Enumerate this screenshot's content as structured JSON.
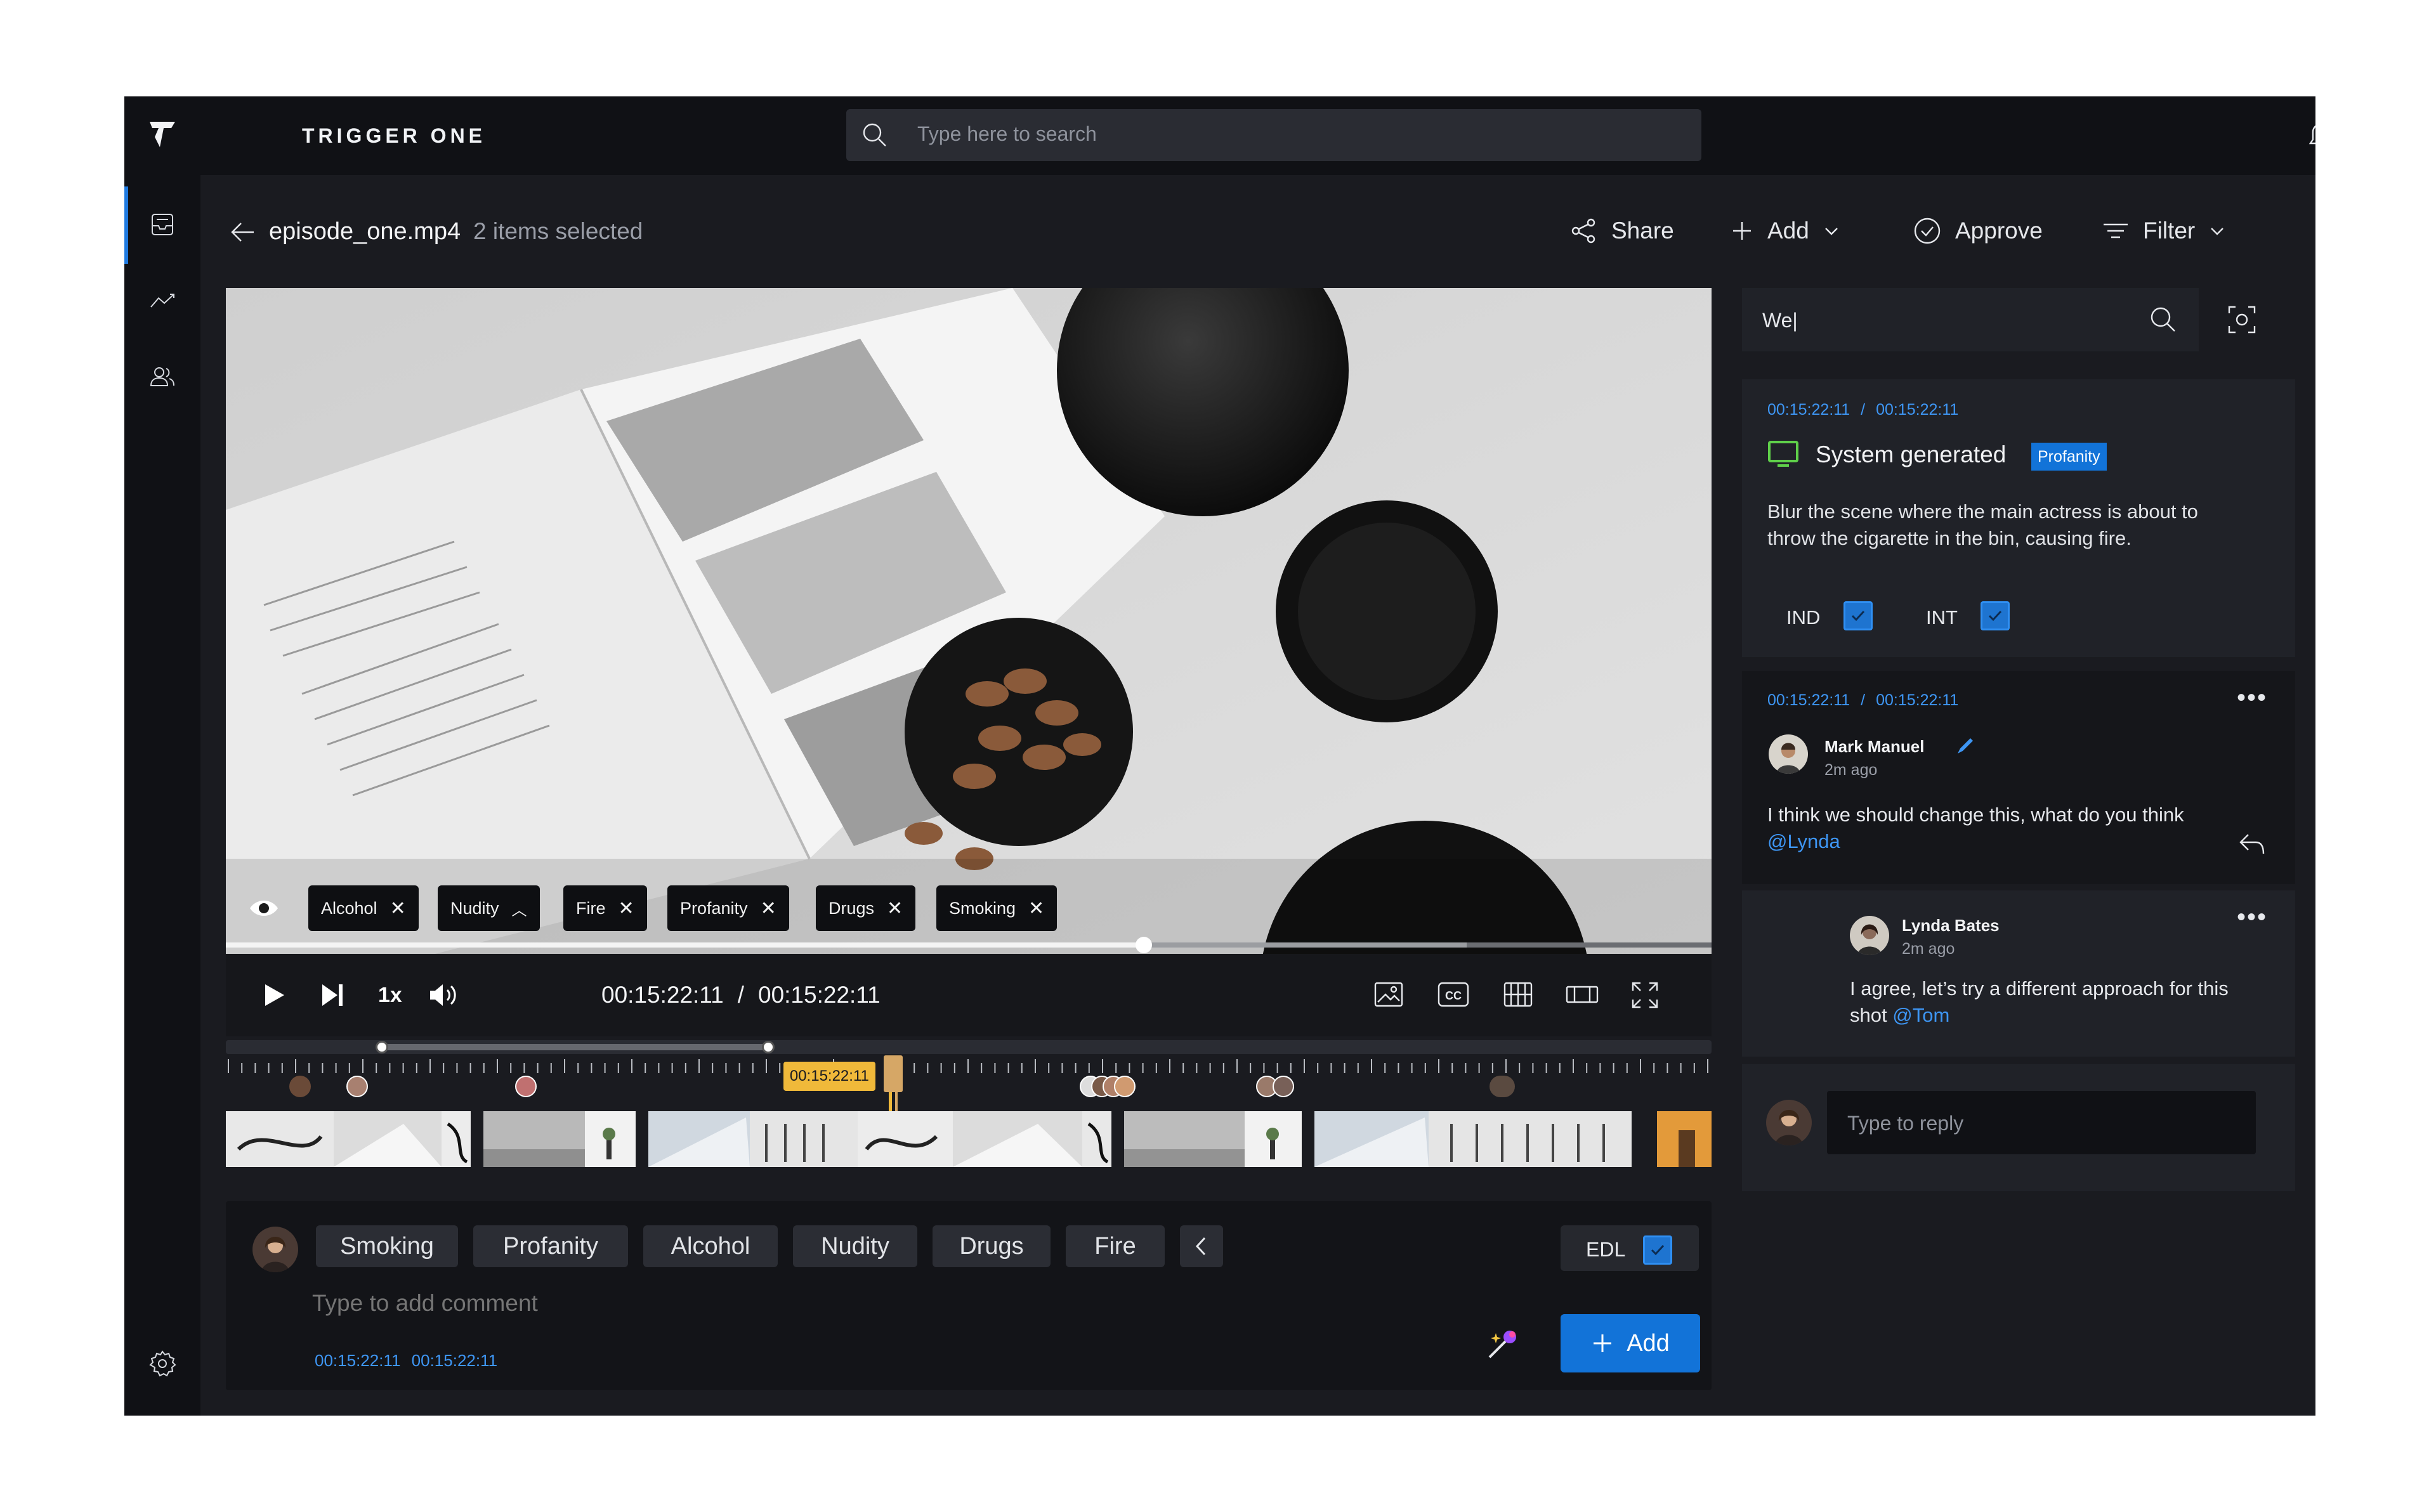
{
  "app": {
    "brand": "TRIGGER ONE"
  },
  "search": {
    "placeholder": "Type here to search"
  },
  "header": {
    "file_name": "episode_one.mp4",
    "selection": "2 items selected",
    "share_label": "Share",
    "add_label": "Add",
    "approve_label": "Approve",
    "filter_label": "Filter"
  },
  "video_tags": [
    {
      "label": "Alcohol",
      "icon": "close-icon"
    },
    {
      "label": "Nudity",
      "icon": "chevron-up-icon"
    },
    {
      "label": "Fire",
      "icon": "close-icon"
    },
    {
      "label": "Profanity",
      "icon": "close-icon"
    },
    {
      "label": "Drugs",
      "icon": "close-icon"
    },
    {
      "label": "Smoking",
      "icon": "close-icon"
    }
  ],
  "player": {
    "speed": "1x",
    "current_time": "00:15:22:11",
    "separator": "/",
    "total_time": "00:15:22:11",
    "progress": 0.618,
    "buffered": 0.835
  },
  "timeline": {
    "marker_time": "00:15:22:11",
    "range_start": 0.105,
    "range_end": 0.365,
    "playhead": 0.447
  },
  "composer": {
    "chips": [
      "Smoking",
      "Profanity",
      "Alcohol",
      "Nudity",
      "Drugs",
      "Fire"
    ],
    "edl_label": "EDL",
    "placeholder": "Type to add comment",
    "time_start": "00:15:22:11",
    "time_end": "00:15:22:11",
    "add_label": "Add"
  },
  "right_panel": {
    "search_value": "We|",
    "system_card": {
      "time_start": "00:15:22:11",
      "separator": "/",
      "time_end": "00:15:22:11",
      "title": "System generated",
      "badge": "Profanity",
      "body": "Blur the scene where the main actress is about to throw the cigarette in the bin, causing fire.",
      "checkbox_1": "IND",
      "checkbox_2": "INT"
    },
    "comment_1": {
      "time_start": "00:15:22:11",
      "separator": "/",
      "time_end": "00:15:22:11",
      "author": "Mark Manuel",
      "ago": "2m ago",
      "text": "I think we should change this, what do you think",
      "mention": "@Lynda"
    },
    "comment_2": {
      "author": "Lynda Bates",
      "ago": "2m ago",
      "text": "I agree, let’s try a different approach for this shot",
      "mention": "@Tom"
    },
    "reply_placeholder": "Type to reply"
  },
  "colors": {
    "accent": "#1f7ae0",
    "link": "#3e96f4",
    "badge": "#1273d8",
    "marker": "#f0b93a",
    "panel": "#202228",
    "background": "#1a1b20"
  }
}
